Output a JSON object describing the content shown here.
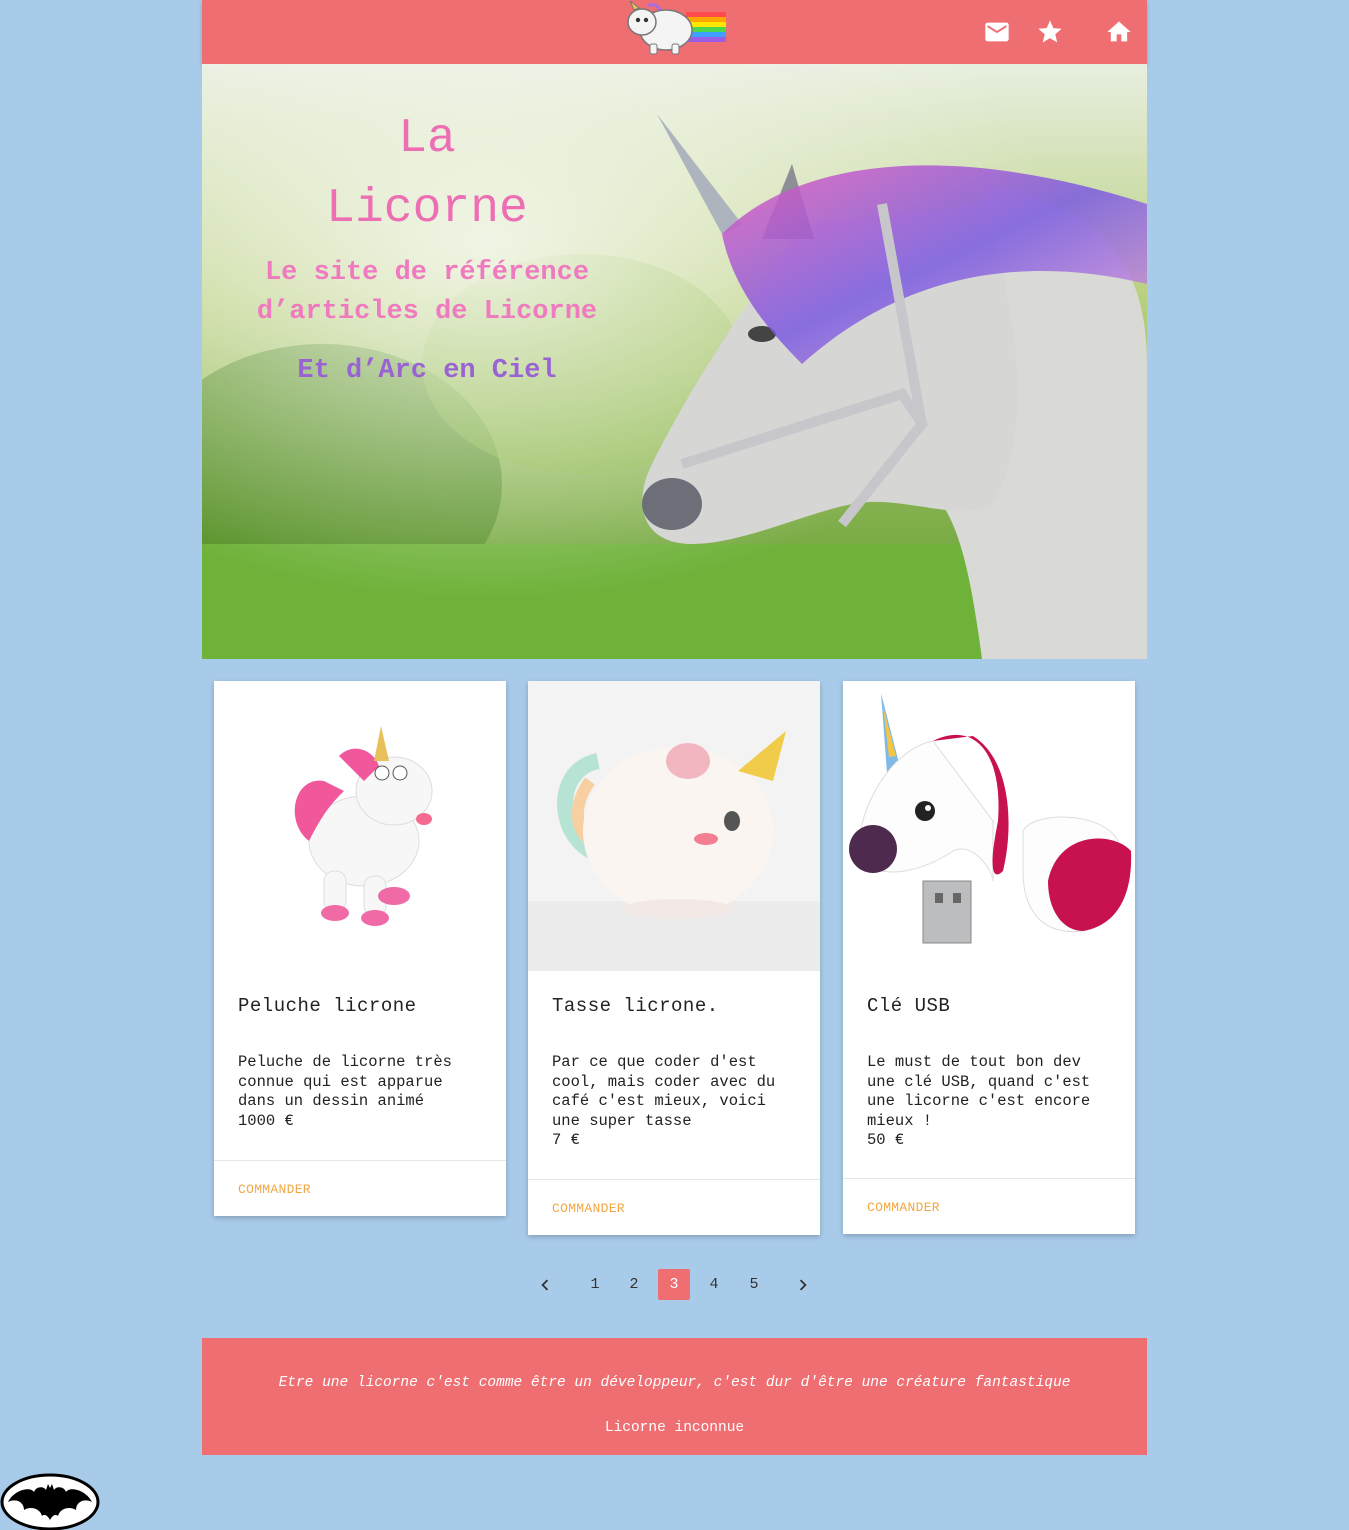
{
  "nav": {
    "logo": "unicorn-rainbow-logo",
    "icons": [
      "mail-icon",
      "star-icon",
      "home-icon"
    ],
    "color": "#ef6e72"
  },
  "hero": {
    "title_line1": "La",
    "title_line2": "Licorne",
    "subtitle_line1": "Le site de référence",
    "subtitle_line2": "d’articles de Licorne",
    "tagline": "Et d’Arc en Ciel"
  },
  "cards": [
    {
      "title": "Peluche licrone",
      "desc": "Peluche de licorne très connue qui est apparue dans un dessin animé",
      "price": "1000 €",
      "action": "COMMANDER"
    },
    {
      "title": "Tasse licrone.",
      "desc": "Par ce que coder d'est cool, mais coder avec du café c'est mieux, voici une super tasse",
      "price": "7 €",
      "action": "COMMANDER"
    },
    {
      "title": "Clé USB",
      "desc": "Le must de tout bon dev une clé USB, quand c'est une licorne c'est encore mieux !",
      "price": "50 €",
      "action": "COMMANDER"
    }
  ],
  "pagination": {
    "pages": [
      "1",
      "2",
      "3",
      "4",
      "5"
    ],
    "active": "3"
  },
  "footer": {
    "quote": "Etre une licorne c'est comme être un développeur, c'est dur d'être une créature fantastique",
    "author": "Licorne inconnue"
  },
  "colors": {
    "background": "#a9cbea",
    "accent": "#ef6e72",
    "action": "#f3a642"
  }
}
